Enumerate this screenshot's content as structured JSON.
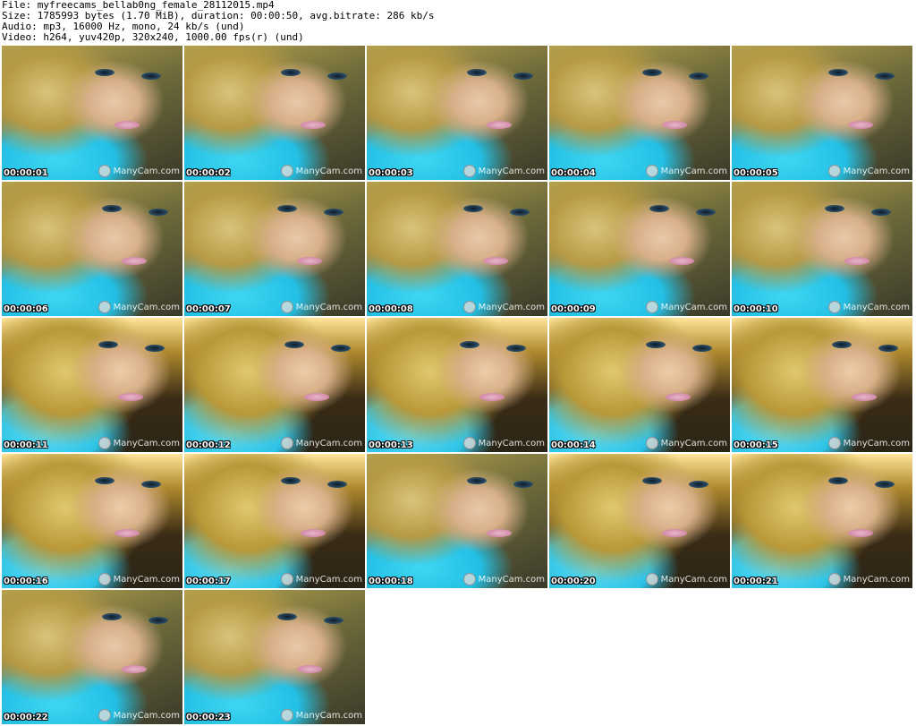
{
  "header": {
    "file_line": "File: myfreecams_bellab0ng_female_28112015.mp4",
    "size_line": "Size: 1785993 bytes (1.70 MiB), duration: 00:00:50, avg.bitrate: 286 kb/s",
    "audio_line": "Audio: mp3, 16000 Hz, mono, 24 kb/s (und)",
    "video_line": "Video: h264, yuv420p, 320x240, 1000.00 fps(r) (und)"
  },
  "watermark": "ManyCam.com",
  "thumbnails": [
    {
      "time": "00:00:01",
      "warm": false
    },
    {
      "time": "00:00:02",
      "warm": false
    },
    {
      "time": "00:00:03",
      "warm": false
    },
    {
      "time": "00:00:04",
      "warm": false
    },
    {
      "time": "00:00:05",
      "warm": false
    },
    {
      "time": "00:00:06",
      "warm": false
    },
    {
      "time": "00:00:07",
      "warm": false
    },
    {
      "time": "00:00:08",
      "warm": false
    },
    {
      "time": "00:00:09",
      "warm": false
    },
    {
      "time": "00:00:10",
      "warm": false
    },
    {
      "time": "00:00:11",
      "warm": true
    },
    {
      "time": "00:00:12",
      "warm": true
    },
    {
      "time": "00:00:13",
      "warm": true
    },
    {
      "time": "00:00:14",
      "warm": true
    },
    {
      "time": "00:00:15",
      "warm": true
    },
    {
      "time": "00:00:16",
      "warm": true
    },
    {
      "time": "00:00:17",
      "warm": true
    },
    {
      "time": "00:00:18",
      "warm": false
    },
    {
      "time": "00:00:20",
      "warm": true
    },
    {
      "time": "00:00:21",
      "warm": true
    },
    {
      "time": "00:00:22",
      "warm": false
    },
    {
      "time": "00:00:23",
      "warm": false
    }
  ]
}
